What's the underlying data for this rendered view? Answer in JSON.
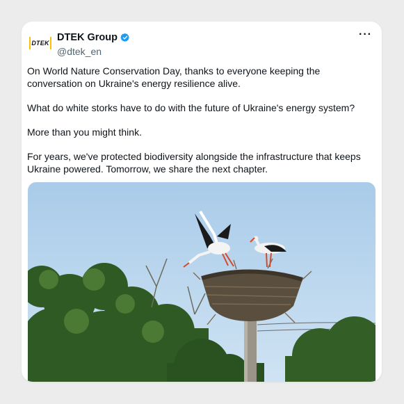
{
  "post": {
    "author_name": "DTEK Group",
    "author_handle": "@dtek_en",
    "avatar_logo_text": "DTEK",
    "more_label": "···",
    "paragraphs": [
      "On World Nature Conservation Day, thanks to everyone keeping the conversation on Ukraine's energy resilience alive.",
      "What do white storks have to do with the future of Ukraine's energy system?",
      "More than you might think.",
      "For years, we've protected biodiversity alongside the infrastructure that keeps Ukraine powered. Tomorrow, we share the next chapter."
    ]
  },
  "colors": {
    "verified_badge": "#1d9bf0",
    "logo_accent": "#f6c400",
    "sky": "#b8d6ef"
  },
  "icons": {
    "verified": "verified-badge-icon",
    "more": "more-options-icon"
  }
}
